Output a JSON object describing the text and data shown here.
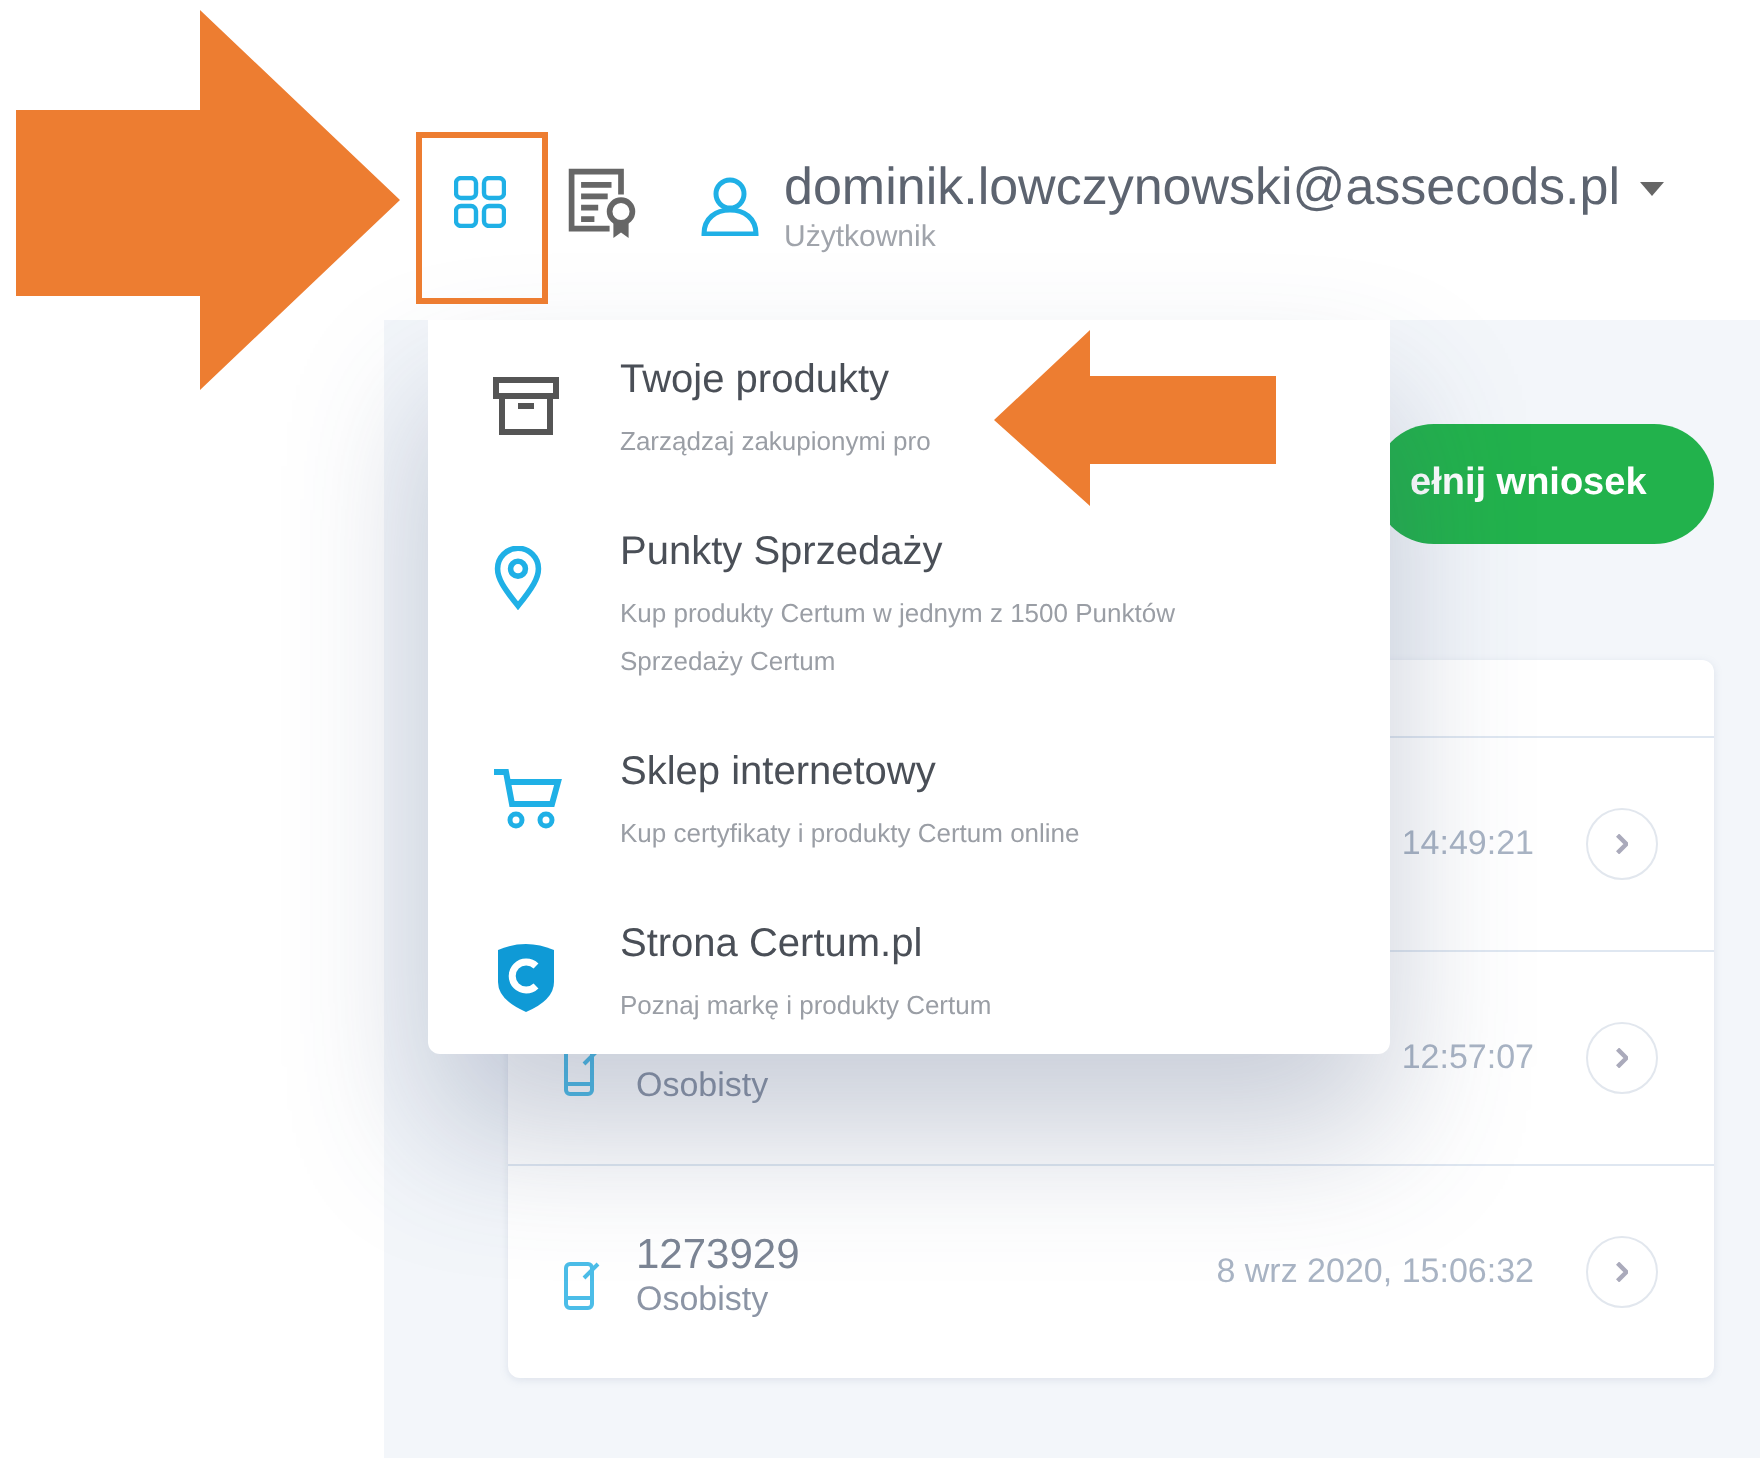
{
  "header": {
    "user": {
      "email": "dominik.lowczynowski@assecods.pl",
      "role": "Użytkownik"
    }
  },
  "apps_menu": {
    "items": [
      {
        "kind": "box",
        "title": "Twoje produkty",
        "subtitle": "Zarządzaj zakupionymi pro"
      },
      {
        "kind": "pin",
        "title": "Punkty Sprzedaży",
        "subtitle": "Kup produkty Certum w jednym z 1500 Punktów Sprzedaży Certum"
      },
      {
        "kind": "cart",
        "title": "Sklep internetowy",
        "subtitle": "Kup certyfikaty i produkty Certum online"
      },
      {
        "kind": "shield",
        "title": "Strona Certum.pl",
        "subtitle": "Poznaj markę i produkty Certum"
      }
    ]
  },
  "primary_button": {
    "label": "ełnij wniosek"
  },
  "table": {
    "rows": [
      {
        "date": "14:49:21"
      },
      {
        "type": "Osobisty",
        "date": "12:57:07"
      },
      {
        "id": "1273929",
        "type": "Osobisty",
        "date": "8 wrz 2020, 15:06:32"
      }
    ]
  }
}
